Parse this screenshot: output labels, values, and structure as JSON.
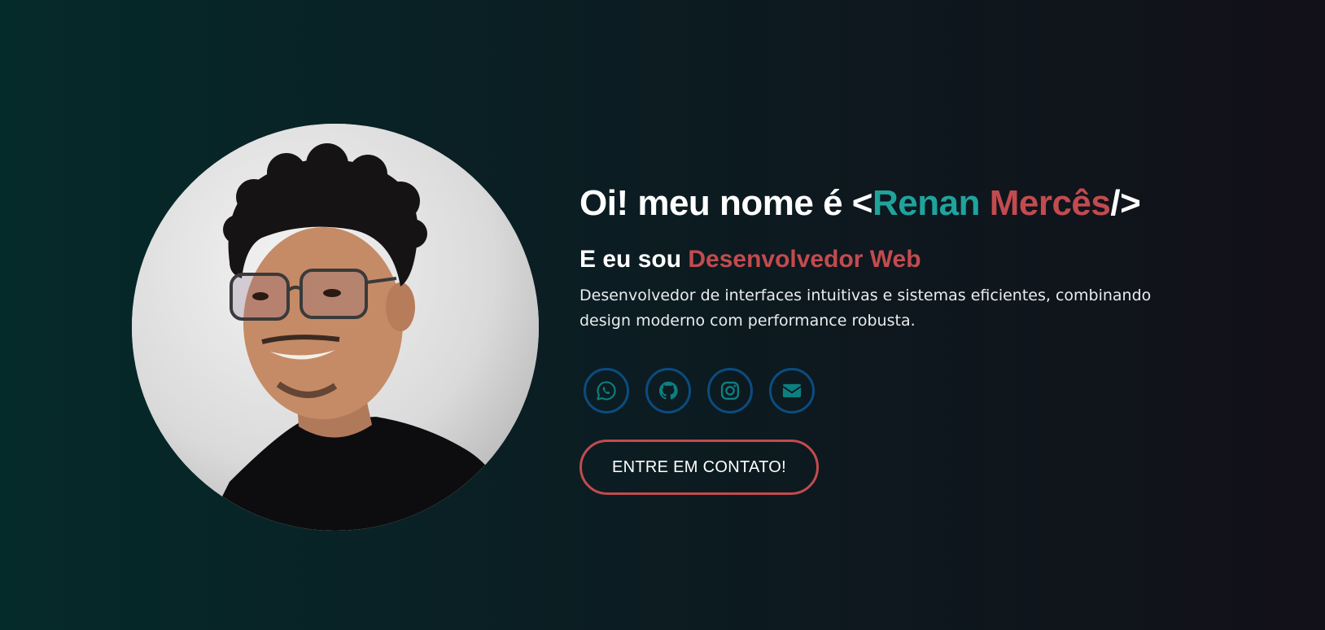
{
  "hero": {
    "greeting": "Oi! meu nome é ",
    "bracket_open": "<",
    "name_first": "Renan ",
    "name_last": "Mercês",
    "bracket_close": "/>",
    "subtitle_prefix": "E eu sou ",
    "role": "Desenvolvedor Web",
    "description": "Desenvolvedor de interfaces intuitivas e sistemas eficientes, combinando design moderno com performance robusta.",
    "cta_label": "ENTRE EM CONTATO!"
  },
  "socials": [
    {
      "icon": "whatsapp-icon"
    },
    {
      "icon": "github-icon"
    },
    {
      "icon": "instagram-icon"
    },
    {
      "icon": "email-icon"
    }
  ],
  "colors": {
    "accent_teal": "#1fa39c",
    "accent_red": "#c24b4f",
    "icon_border": "#0a4c80",
    "icon_fill": "#0d7f80"
  }
}
